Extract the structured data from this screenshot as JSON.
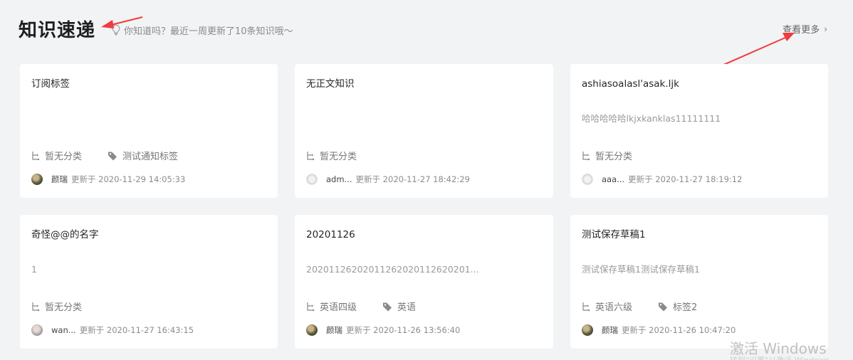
{
  "header": {
    "title": "知识速递",
    "tip": "你知道吗？最近一周更新了10条知识哦～",
    "more_label": "查看更多",
    "more_icon": "chevron-right-icon"
  },
  "cards": [
    {
      "title": "订阅标签",
      "body": "",
      "category": "暂无分类",
      "tag": "测试通知标签",
      "user": "颜瑞",
      "updated": "更新于 2020-11-29 14:05:33",
      "avatar": "dark"
    },
    {
      "title": "无正文知识",
      "body": "",
      "category": "暂无分类",
      "tag": "",
      "user": "adm...",
      "updated": "更新于 2020-11-27 18:42:29",
      "avatar": "light"
    },
    {
      "title": "ashiasoalasl'asak.ljk",
      "body": "哈哈哈哈哈lkjxkanklas11111111",
      "category": "暂无分类",
      "tag": "",
      "user": "aaa...",
      "updated": "更新于 2020-11-27 18:19:12",
      "avatar": "light"
    },
    {
      "title": "奇怪@@的名字",
      "body": "1",
      "category": "暂无分类",
      "tag": "",
      "user": "wan...",
      "updated": "更新于 2020-11-27 16:43:15",
      "avatar": "mix"
    },
    {
      "title": "20201126",
      "body": "20201126202011262020112620201...",
      "category": "英语四级",
      "tag": "英语",
      "user": "颜瑞",
      "updated": "更新于 2020-11-26 13:56:40",
      "avatar": "dark"
    },
    {
      "title": "测试保存草稿1",
      "body": "测试保存草稿1测试保存草稿1",
      "category": "英语六级",
      "tag": "标签2",
      "user": "颜瑞",
      "updated": "更新于 2020-11-26 10:47:20",
      "avatar": "dark"
    }
  ],
  "watermark": {
    "line1": "激活 Windows",
    "line2": "转到\"设置\"以激活 Windows。"
  },
  "colors": {
    "background": "#f2f3f5",
    "card": "#ffffff",
    "annotation_arrow": "#f03c3c"
  }
}
